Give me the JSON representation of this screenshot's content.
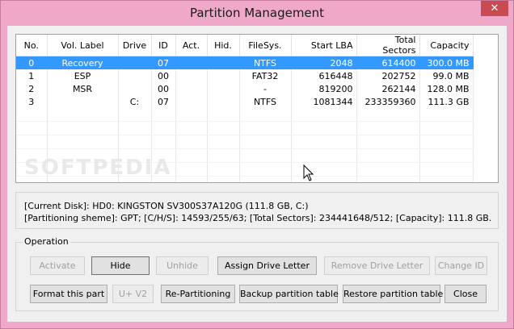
{
  "window": {
    "title": "Partition Management",
    "close_glyph": "✕"
  },
  "table": {
    "headers": [
      "No.",
      "Vol. Label",
      "Drive",
      "ID",
      "Act.",
      "Hid.",
      "FileSys.",
      "Start LBA",
      "Total Sectors",
      "Capacity"
    ],
    "rows": [
      [
        "0",
        "Recovery",
        "",
        "07",
        "",
        "",
        "NTFS",
        "2048",
        "614400",
        "300.0 MB"
      ],
      [
        "1",
        "ESP",
        "",
        "00",
        "",
        "",
        "FAT32",
        "616448",
        "202752",
        "99.0 MB"
      ],
      [
        "2",
        "MSR",
        "",
        "00",
        "",
        "",
        "-",
        "819200",
        "262144",
        "128.0 MB"
      ],
      [
        "3",
        "",
        "C:",
        "07",
        "",
        "",
        "NTFS",
        "1081344",
        "233359360",
        "111.3 GB"
      ]
    ],
    "selected_row": 0
  },
  "watermark": "SOFTPEDIA",
  "info": {
    "current_disk": "[Current Disk]:    HD0: KINGSTON SV300S37A120G (111.8 GB, C:)",
    "partitioning": "[Partitioning sheme]:    GPT;      [C/H/S]:  14593/255/63; [Total Sectors]: 234441648/512; [Capacity]: 111.8 GB."
  },
  "operation": {
    "label": "Operation",
    "activate": "Activate",
    "hide": "Hide",
    "unhide": "Unhide",
    "assign_drive_letter": "Assign Drive Letter",
    "remove_drive_letter": "Remove Drive Letter",
    "change_id": "Change ID",
    "format_part": "Format this part",
    "u_v2": "U+ V2",
    "re_partitioning": "Re-Partitioning",
    "backup_table": "Backup partition table",
    "restore_table": "Restore partition table",
    "close": "Close"
  }
}
